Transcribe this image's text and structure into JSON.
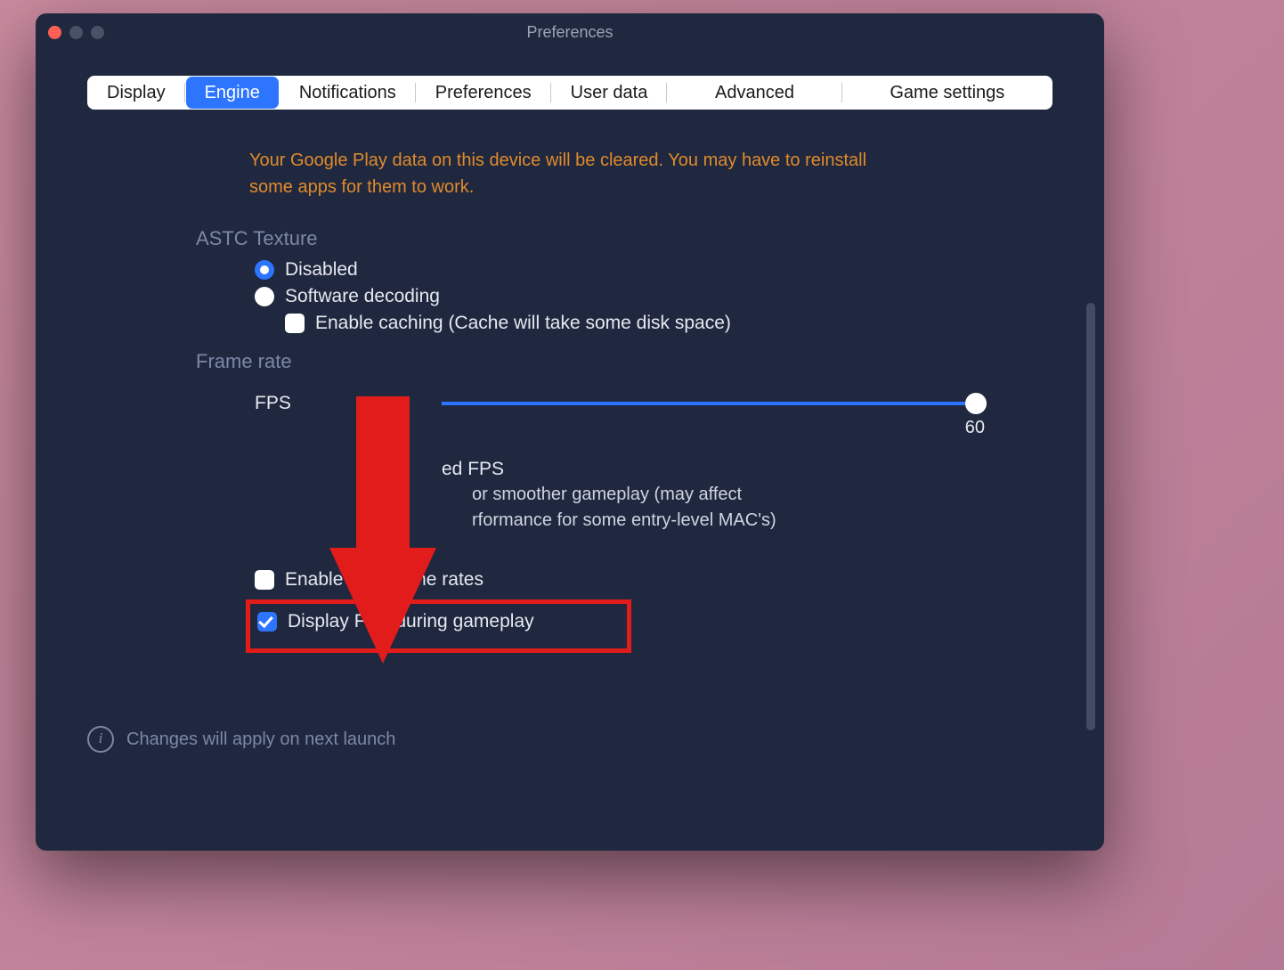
{
  "window": {
    "title": "Preferences"
  },
  "tabs": {
    "display": "Display",
    "engine": "Engine",
    "notifications": "Notifications",
    "preferences": "Preferences",
    "userdata": "User data",
    "advanced": "Advanced",
    "gamesettings": "Game settings"
  },
  "warning": "Your Google Play data on this device will be cleared. You may have to reinstall some apps for them to work.",
  "astc": {
    "heading": "ASTC Texture",
    "disabled": "Disabled",
    "software": "Software decoding",
    "caching": "Enable caching (Cache will take some disk space)"
  },
  "frame": {
    "heading": "Frame rate",
    "fps_label": "FPS",
    "fps_value": "60",
    "vsync_title": "ed FPS",
    "vsync_line1": "or smoother gameplay (may affect",
    "vsync_line2": "rformance for some entry-level MAC's)",
    "high_frames": "Enable high frame rates",
    "display_fps": "Display FPS during gameplay"
  },
  "footer": "Changes will apply on next launch"
}
